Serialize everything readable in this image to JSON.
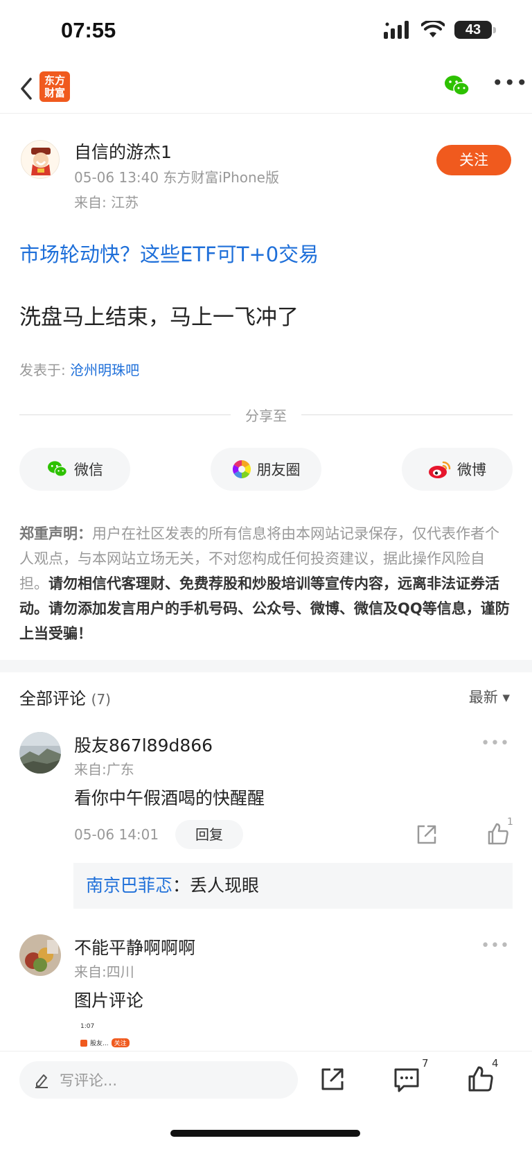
{
  "status_bar": {
    "time": "07:55",
    "battery": "43"
  },
  "nav": {
    "logo_text": "东方\n财富"
  },
  "author": {
    "name": "自信的游杰1",
    "meta": "05-06 13:40 东方财富iPhone版",
    "from": "来自: 江苏",
    "follow_label": "关注"
  },
  "post": {
    "promo_link": "市场轮动快？这些ETF可T+0交易",
    "body": "洗盘马上结束，马上一飞冲了",
    "posted_in_label": "发表于: ",
    "posted_in_bar": "沧州明珠吧"
  },
  "share": {
    "label": "分享至",
    "wechat": "微信",
    "moments": "朋友圈",
    "weibo": "微博"
  },
  "disclaimer": {
    "title": "郑重声明：",
    "normal": "用户在社区发表的所有信息将由本网站记录保存，仅代表作者个人观点，与本网站立场无关，不对您构成任何投资建议，据此操作风险自担。",
    "bold": "请勿相信代客理财、免费荐股和炒股培训等宣传内容，远离非法证券活动。请勿添加发言用户的手机号码、公众号、微博、微信及QQ等信息，谨防上当受骗！"
  },
  "comments_section": {
    "title": "全部评论",
    "count": "(7)",
    "sort_label": "最新 ▾"
  },
  "comments": [
    {
      "name": "股友867l89d866",
      "from": "来自:广东",
      "text": "看你中午假酒喝的快醒醒",
      "time": "05-06 14:01",
      "reply_label": "回复",
      "likes": "1",
      "sub_reply_user": "南京巴菲忑",
      "sub_reply_sep": "：",
      "sub_reply_text": "丢人现眼"
    },
    {
      "name": "不能平静啊啊啊",
      "from": "来自:四川",
      "text": "图片评论",
      "thumb_time": "1:07",
      "thumb_text": "股友...",
      "thumb_follow": "关注"
    }
  ],
  "bottom_bar": {
    "input_placeholder": "写评论...",
    "comment_count": "7",
    "like_count": "4"
  }
}
